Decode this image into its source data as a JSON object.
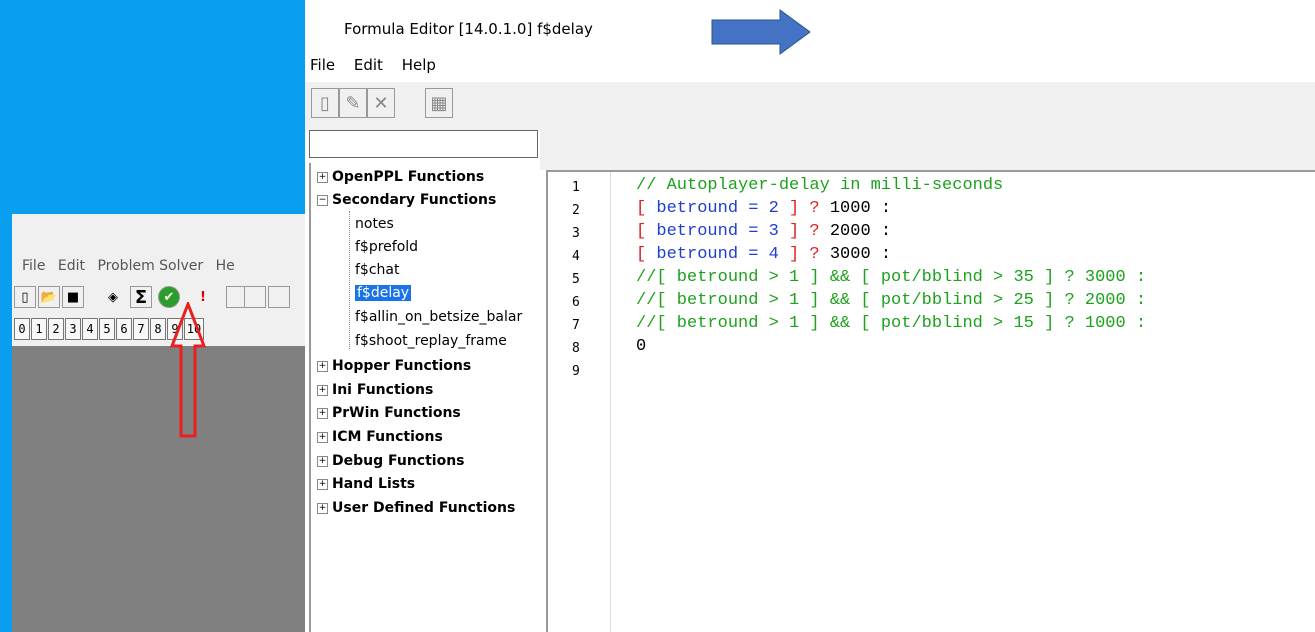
{
  "background_window": {
    "menu": [
      "File",
      "Edit",
      "Problem Solver",
      "He"
    ],
    "number_buttons": [
      "0",
      "1",
      "2",
      "3",
      "4",
      "5",
      "6",
      "7",
      "8",
      "9",
      "10"
    ]
  },
  "formula_editor": {
    "title": "Formula Editor [14.0.1.0] f$delay",
    "menu": [
      "File",
      "Edit",
      "Help"
    ],
    "search_value": "",
    "tree": [
      {
        "label": "OpenPPL Functions",
        "bold": true,
        "expander": "+"
      },
      {
        "label": "Secondary Functions",
        "bold": true,
        "expander": "−"
      },
      {
        "label": "notes",
        "child": true
      },
      {
        "label": "f$prefold",
        "child": true
      },
      {
        "label": "f$chat",
        "child": true
      },
      {
        "label": "f$delay",
        "child": true,
        "selected": true
      },
      {
        "label": "f$allin_on_betsize_balar",
        "child": true
      },
      {
        "label": "f$shoot_replay_frame",
        "child": true
      },
      {
        "label": "Hopper Functions",
        "bold": true,
        "expander": "+"
      },
      {
        "label": "Ini Functions",
        "bold": true,
        "expander": "+"
      },
      {
        "label": "PrWin Functions",
        "bold": true,
        "expander": "+"
      },
      {
        "label": "ICM Functions",
        "bold": true,
        "expander": "+"
      },
      {
        "label": "Debug Functions",
        "bold": true,
        "expander": "+"
      },
      {
        "label": "Hand Lists",
        "bold": true,
        "expander": "+"
      },
      {
        "label": "User Defined Functions",
        "bold": true,
        "expander": "+"
      }
    ],
    "line_numbers": [
      "1",
      "2",
      "3",
      "4",
      "5",
      "6",
      "7",
      "8",
      "9"
    ],
    "code": {
      "l1": "// Autoplayer-delay in milli-seconds",
      "l2a": "[",
      "l2b": " betround = 2 ",
      "l2c": "] ? ",
      "l2d": "1000 :",
      "l3a": "[",
      "l3b": " betround = 3 ",
      "l3c": "] ? ",
      "l3d": "2000 :",
      "l4a": "[",
      "l4b": " betround = 4 ",
      "l4c": "] ? ",
      "l4d": "3000 :",
      "l5": "//[ betround > 1 ] && [ pot/bblind > 35 ] ? 3000 :",
      "l6": "//[ betround > 1 ] && [ pot/bblind > 25 ] ? 2000 :",
      "l7": "//[ betround > 1 ] && [ pot/bblind > 15 ] ? 1000 :",
      "l8": "0"
    }
  },
  "colors": {
    "comment": "#1da21d",
    "bracket": "#e02020",
    "symbol": "#1e3fcf",
    "selection": "#1a73e8",
    "desktop": "#0a9ef0"
  }
}
